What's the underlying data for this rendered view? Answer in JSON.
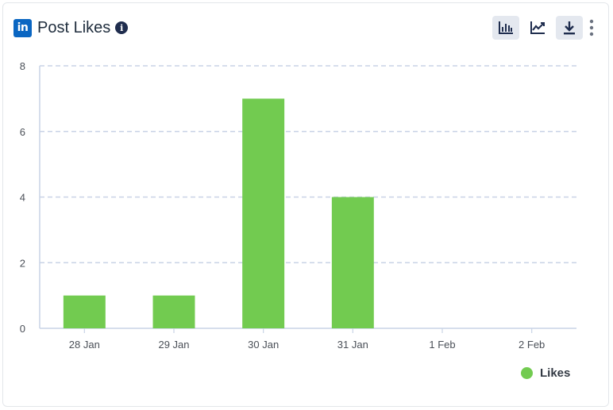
{
  "header": {
    "title": "Post Likes",
    "logo_text": "in",
    "info_icon": "info-icon",
    "tools": [
      "bar-chart-icon",
      "line-chart-icon",
      "download-icon",
      "more-vertical-icon"
    ]
  },
  "colors": {
    "bar": "#72cb50",
    "grid": "#c9d3e6",
    "axis": "#c9d3e6",
    "tick_text": "#4a4f57",
    "brand": "#0a66c2"
  },
  "chart_data": {
    "type": "bar",
    "categories": [
      "28 Jan",
      "29 Jan",
      "30 Jan",
      "31 Jan",
      "1 Feb",
      "2 Feb"
    ],
    "series": [
      {
        "name": "Likes",
        "values": [
          1,
          1,
          7,
          4,
          0,
          0
        ]
      }
    ],
    "ylim": [
      0,
      8
    ],
    "yticks": [
      0,
      2,
      4,
      6,
      8
    ],
    "grid": true,
    "legend": "bottom-right"
  }
}
